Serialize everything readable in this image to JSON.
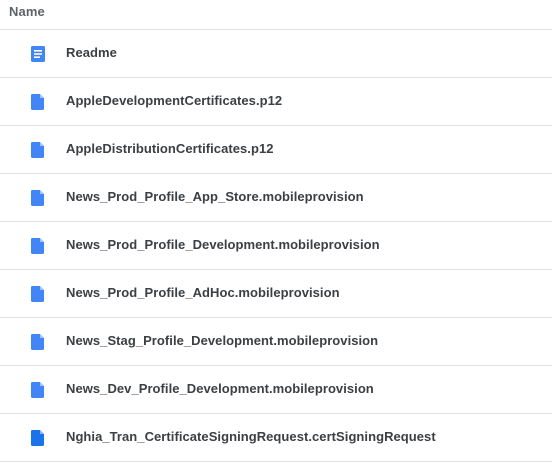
{
  "header": {
    "name_label": "Name"
  },
  "files": [
    {
      "name": "Readme",
      "icon": "doc-icon",
      "color": "#4285f4"
    },
    {
      "name": "AppleDevelopmentCertificates.p12",
      "icon": "file-icon",
      "color": "#4285f4"
    },
    {
      "name": "AppleDistributionCertificates.p12",
      "icon": "file-icon",
      "color": "#4285f4"
    },
    {
      "name": "News_Prod_Profile_App_Store.mobileprovision",
      "icon": "file-icon",
      "color": "#4285f4"
    },
    {
      "name": "News_Prod_Profile_Development.mobileprovision",
      "icon": "file-icon",
      "color": "#4285f4"
    },
    {
      "name": "News_Prod_Profile_AdHoc.mobileprovision",
      "icon": "file-icon",
      "color": "#4285f4"
    },
    {
      "name": "News_Stag_Profile_Development.mobileprovision",
      "icon": "file-icon",
      "color": "#4285f4"
    },
    {
      "name": "News_Dev_Profile_Development.mobileprovision",
      "icon": "file-icon",
      "color": "#4285f4"
    },
    {
      "name": "Nghia_Tran_CertificateSigningRequest.certSigningRequest",
      "icon": "file-icon",
      "color": "#1a73e8"
    }
  ]
}
